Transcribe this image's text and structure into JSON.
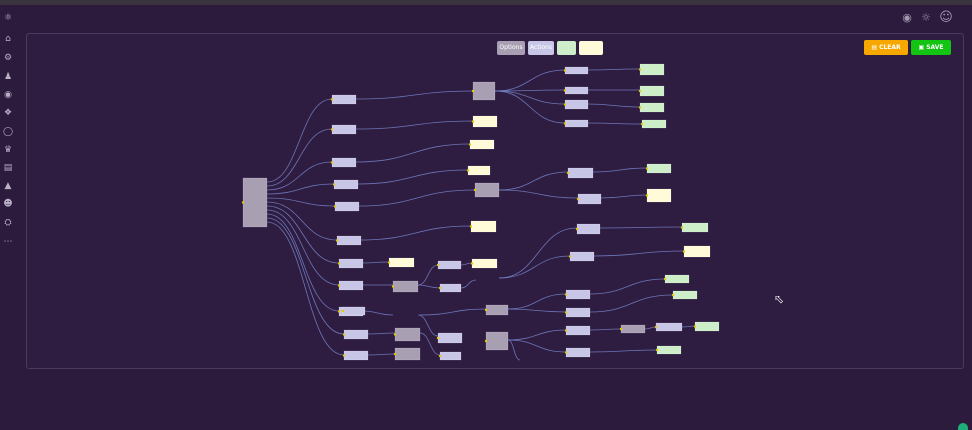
{
  "header": {
    "icons": [
      "globe-icon",
      "sun-icon",
      "user-icon"
    ]
  },
  "sidebar": {
    "items": [
      "motorbike-icon",
      "home-icon",
      "bike-icon",
      "rider-icon",
      "group-icon",
      "gear-cluster-icon",
      "shield-icon",
      "scooter-icon",
      "gallery-icon",
      "garage-icon",
      "team-icon",
      "settings-icon",
      "more-icon"
    ]
  },
  "legend": {
    "chips": [
      {
        "label": "Options",
        "color": "#a89fb3"
      },
      {
        "label": "Actions",
        "color": "#c8c6e6"
      },
      {
        "label": "",
        "color": "#cdeec8"
      },
      {
        "label": "",
        "color": "#fffbd9"
      }
    ]
  },
  "toolbar": {
    "clear_label": "CLEAR",
    "save_label": "SAVE",
    "clear_color": "#f6a800",
    "save_color": "#13c413"
  },
  "colors": {
    "option_node": "#a89fb3",
    "action_node": "#c8c6e6",
    "result_node": "#cdeec8",
    "message_node": "#fffbd9",
    "edge": "#7d8cd6",
    "handle": "#e8c800"
  }
}
